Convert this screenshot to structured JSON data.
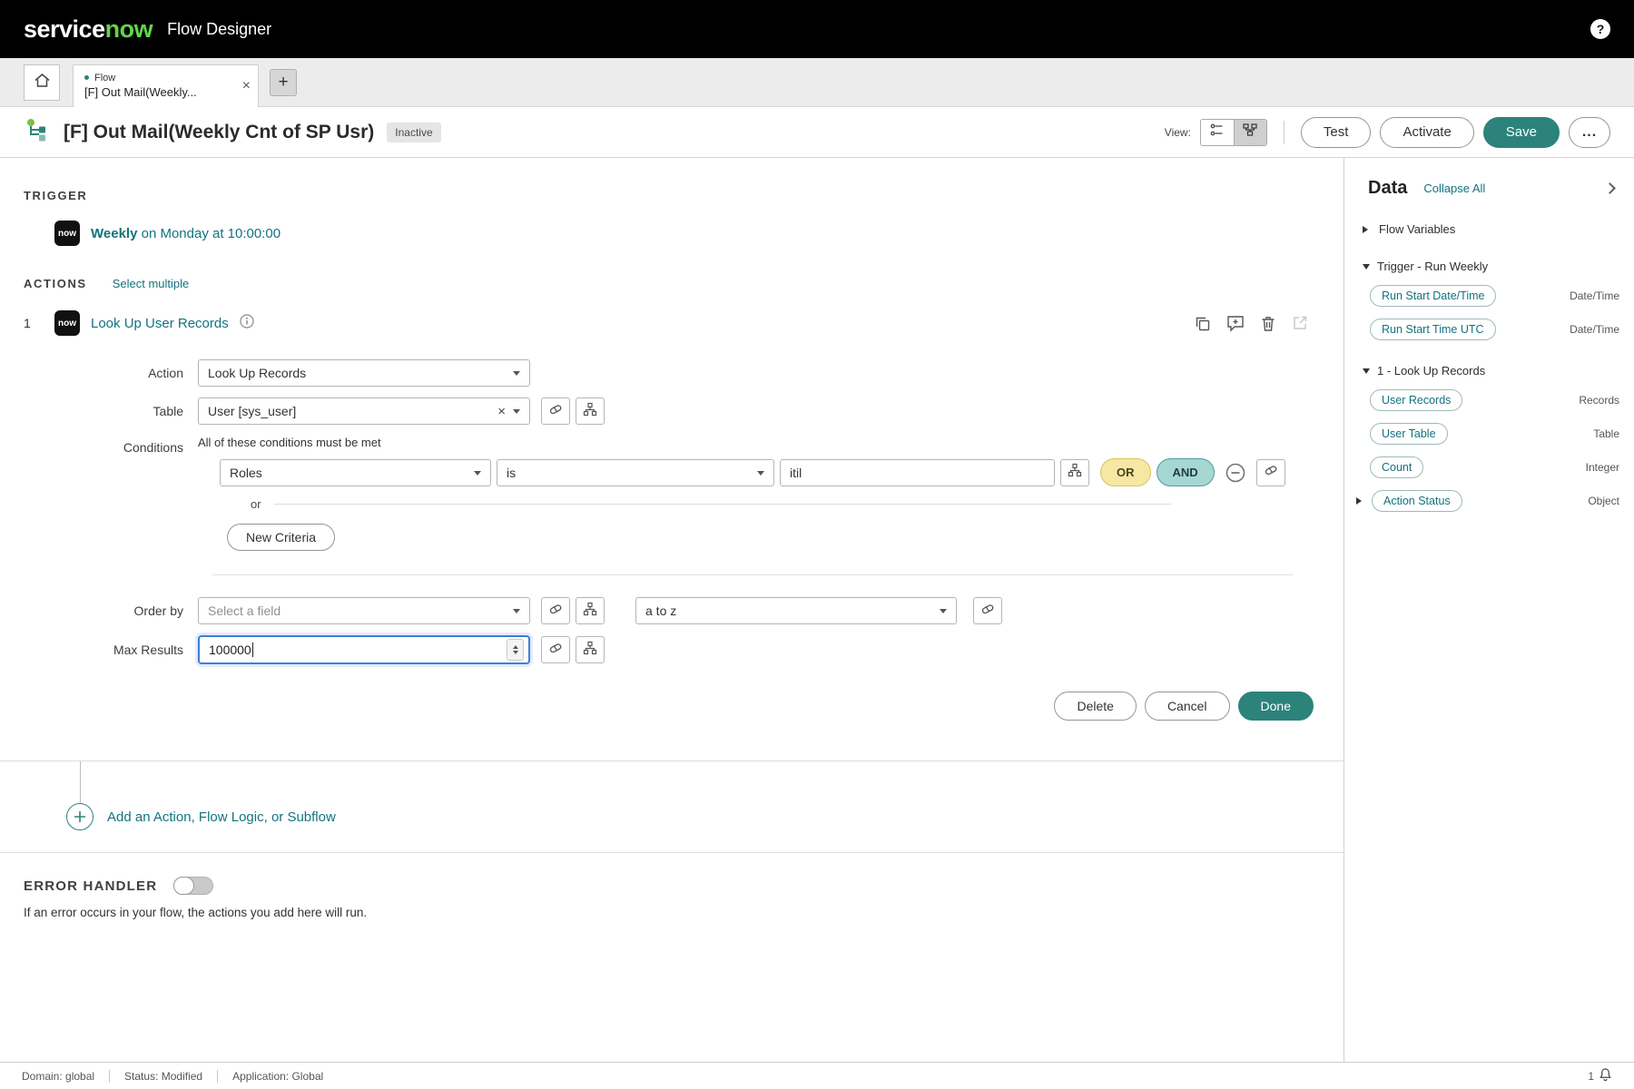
{
  "colors": {
    "brand_green": "#63d44b",
    "teal_primary": "#2b837b",
    "link_teal": "#12737f",
    "and_chip_bg": "#a5d7d3",
    "or_chip_bg": "#f6e8a3",
    "focus_blue": "#3d7fd9"
  },
  "topbar": {
    "logo_service": "service",
    "logo_now": "now",
    "product_name": "Flow Designer"
  },
  "tabbar": {
    "tab_kind": "Flow",
    "tab_title": "[F] Out Mail(Weekly...",
    "close_glyph": "×",
    "new_tab_glyph": "+"
  },
  "page_header": {
    "title": "[F] Out Mail(Weekly Cnt of SP Usr)",
    "status_badge": "Inactive",
    "view_label": "View:",
    "test_button": "Test",
    "activate_button": "Activate",
    "save_button": "Save",
    "more_button": "..."
  },
  "trigger": {
    "section_label": "TRIGGER",
    "now_badge": "now",
    "schedule_name": "Weekly",
    "schedule_detail": "on Monday at 10:00:00"
  },
  "actions": {
    "section_label": "ACTIONS",
    "select_multiple": "Select multiple",
    "action": {
      "index": "1",
      "now_badge": "now",
      "title": "Look Up User Records",
      "action_label": "Action",
      "action_value": "Look Up Records",
      "table_label": "Table",
      "table_value": "User [sys_user]",
      "clear_glyph": "×",
      "conditions_label": "Conditions",
      "conditions_note": "All of these conditions must be met",
      "condition_field": "Roles",
      "condition_operator": "is",
      "condition_value": "itil",
      "or_chip": "OR",
      "and_chip": "AND",
      "or_divider": "or",
      "new_criteria_button": "New Criteria",
      "order_by_label": "Order by",
      "order_by_placeholder": "Select a field",
      "order_direction": "a to z",
      "max_results_label": "Max Results",
      "max_results_value": "100000",
      "delete_button": "Delete",
      "cancel_button": "Cancel",
      "done_button": "Done"
    },
    "add_action_label": "Add an Action, Flow Logic, or Subflow"
  },
  "error_handler": {
    "title": "ERROR HANDLER",
    "description": "If an error occurs in your flow, the actions you add here will run."
  },
  "data_panel": {
    "title": "Data",
    "collapse_all": "Collapse All",
    "sections": [
      {
        "label": "Flow Variables",
        "expanded": false
      },
      {
        "label": "Trigger - Run Weekly",
        "expanded": true,
        "pills": [
          {
            "name": "Run Start Date/Time",
            "type": "Date/Time"
          },
          {
            "name": "Run Start Time UTC",
            "type": "Date/Time"
          }
        ]
      },
      {
        "label": "1 - Look Up Records",
        "expanded": true,
        "pills": [
          {
            "name": "User Records",
            "type": "Records"
          },
          {
            "name": "User Table",
            "type": "Table"
          },
          {
            "name": "Count",
            "type": "Integer"
          },
          {
            "name": "Action Status",
            "type": "Object",
            "expandable": true
          }
        ]
      }
    ]
  },
  "status_bar": {
    "domain": "Domain: global",
    "status": "Status: Modified",
    "application": "Application: Global",
    "notification_count": "1"
  }
}
